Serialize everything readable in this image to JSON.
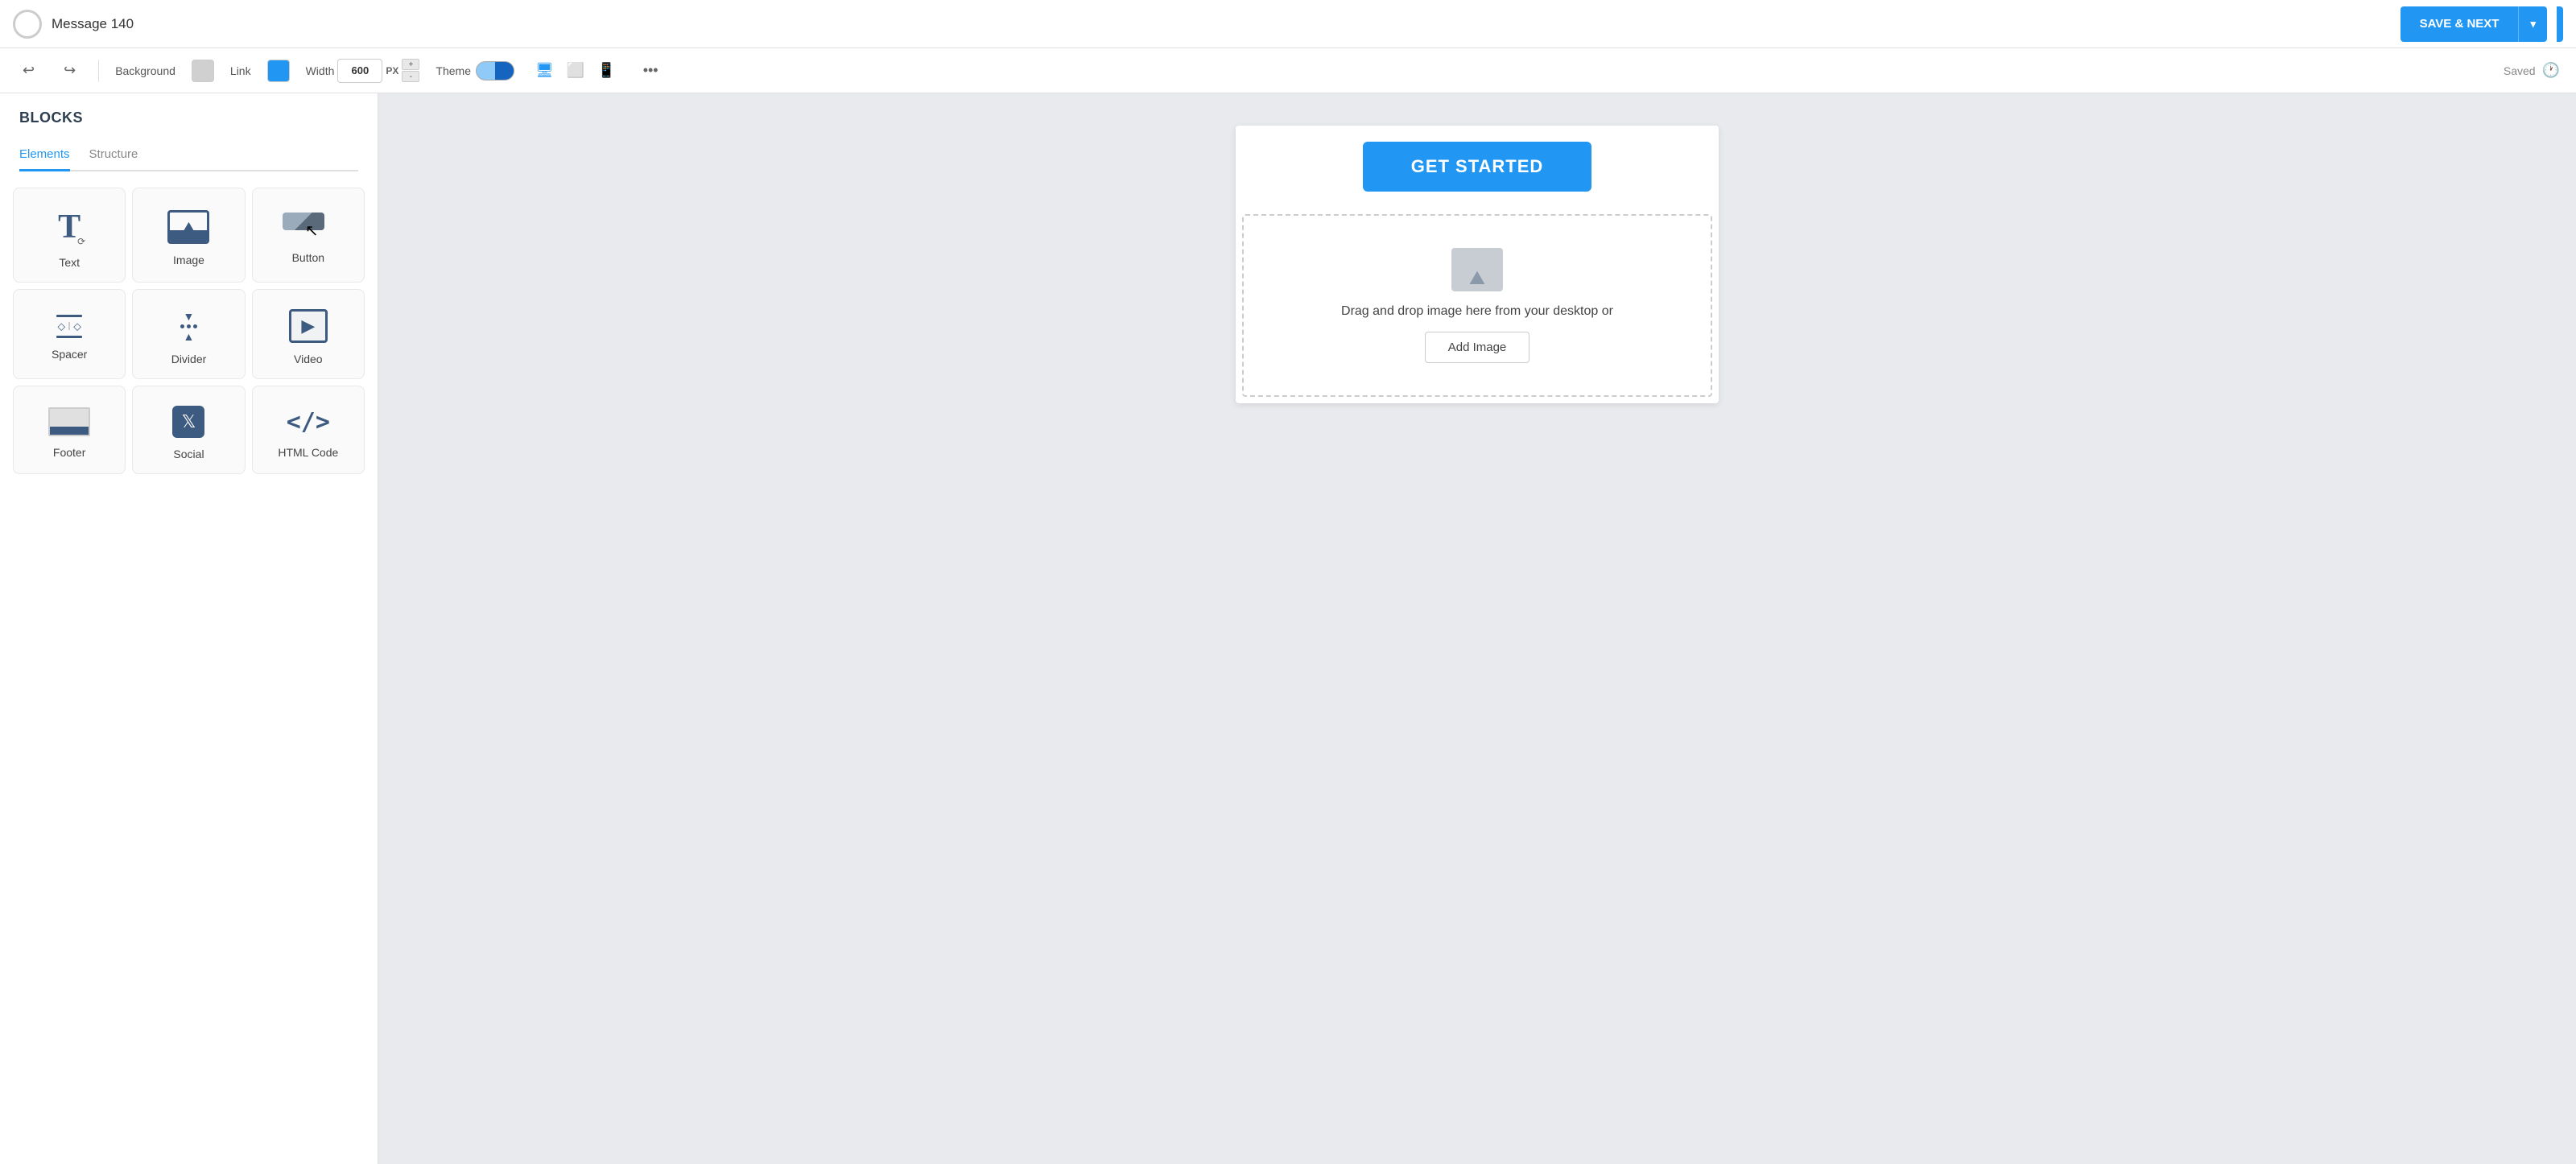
{
  "app": {
    "title": "Message 140",
    "save_label": "SAVE & NEXT",
    "saved_label": "Saved"
  },
  "toolbar": {
    "background_label": "Background",
    "link_label": "Link",
    "width_label": "Width",
    "width_value": "600",
    "width_unit": "PX",
    "theme_label": "Theme",
    "stepper_up": "+",
    "stepper_down": "-"
  },
  "sidebar": {
    "title": "BLOCKS",
    "tabs": [
      {
        "id": "elements",
        "label": "Elements",
        "active": true
      },
      {
        "id": "structure",
        "label": "Structure",
        "active": false
      }
    ],
    "blocks": [
      {
        "id": "text",
        "label": "Text"
      },
      {
        "id": "image",
        "label": "Image"
      },
      {
        "id": "button",
        "label": "Button"
      },
      {
        "id": "spacer",
        "label": "Spacer"
      },
      {
        "id": "divider",
        "label": "Divider"
      },
      {
        "id": "video",
        "label": "Video"
      },
      {
        "id": "footer",
        "label": "Footer"
      },
      {
        "id": "social",
        "label": "Social"
      },
      {
        "id": "html-code",
        "label": "HTML Code"
      }
    ]
  },
  "canvas": {
    "get_started_label": "GET STARTED",
    "drag_drop_text": "Drag and drop image here from your desktop or",
    "add_image_label": "Add Image"
  }
}
